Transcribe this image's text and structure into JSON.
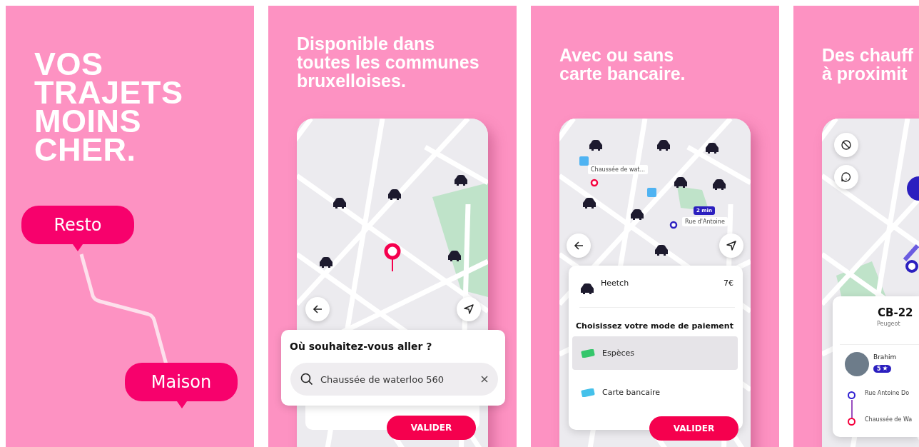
{
  "panels": [
    {
      "kind": "hero",
      "title_lines": [
        "VOS",
        "TRAJETS",
        "MOINS",
        "CHER."
      ],
      "places": [
        {
          "label": "Resto"
        },
        {
          "label": "Maison"
        }
      ]
    },
    {
      "kind": "search",
      "heading_lines": [
        "Disponible dans",
        "toutes les communes",
        "bruxelloises."
      ],
      "prompt": "Où souhaitez-vous aller ?",
      "search": {
        "value": "Chaussée de waterloo 560"
      },
      "button": "VALIDER"
    },
    {
      "kind": "payment",
      "heading_lines": [
        "Avec ou sans",
        "carte bancaire."
      ],
      "map_labels": {
        "eta": "2 min",
        "pickup": "Rue d'Antoine",
        "dropoff": "Chaussée de wat..."
      },
      "ride": {
        "name": "Heetch",
        "price": "7€"
      },
      "payment_title": "Choisissez votre mode de paiement",
      "methods": [
        {
          "label": "Espèces",
          "selected": true
        },
        {
          "label": "Carte bancaire",
          "selected": false
        }
      ],
      "button": "VALIDER"
    },
    {
      "kind": "driver",
      "heading_lines": [
        "Des chauff",
        "à proximit"
      ],
      "plate": "CB-22",
      "car_model": "Peugeot",
      "driver": {
        "name": "Brahim",
        "rating": "5"
      },
      "stops": [
        {
          "label": "Rue Antoine Do",
          "color": "#2f1fd1"
        },
        {
          "label": "Chaussée de Wa",
          "color": "#f5003d"
        }
      ]
    }
  ]
}
